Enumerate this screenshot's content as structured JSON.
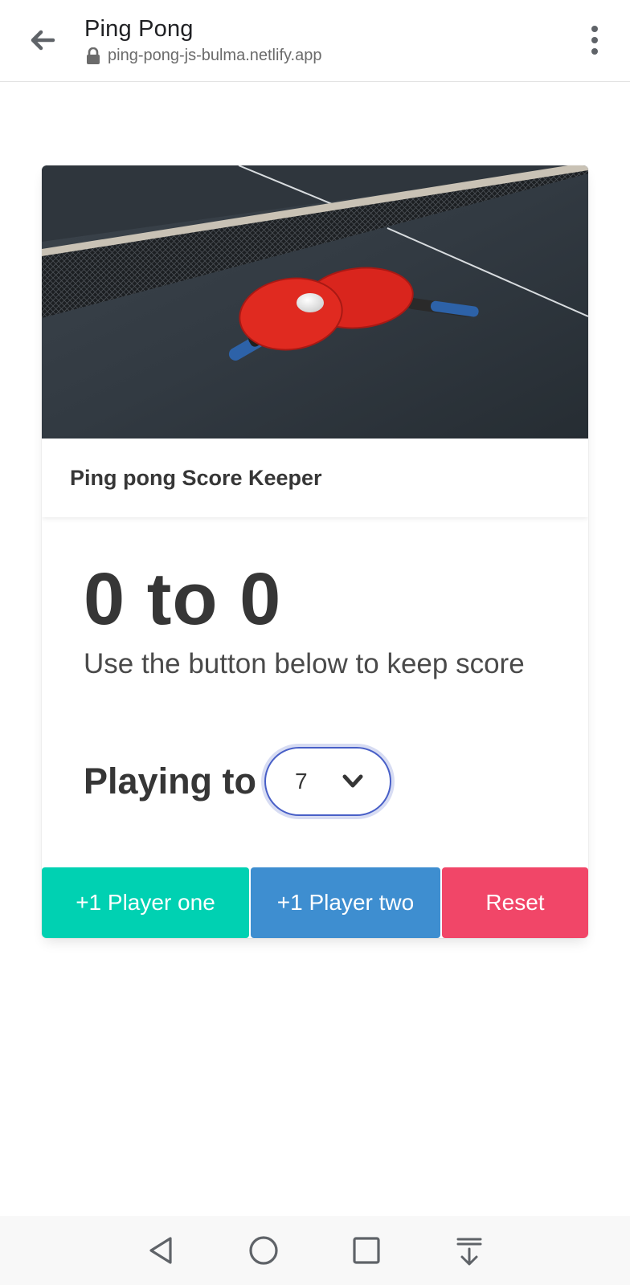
{
  "browser": {
    "title": "Ping Pong",
    "url": "ping-pong-js-bulma.netlify.app",
    "icons": {
      "back": "arrow-left-icon",
      "lock": "lock-icon",
      "menu": "more-vertical-icon"
    }
  },
  "card": {
    "image_alt": "ping pong paddles and ball on table",
    "header_title": "Ping pong Score Keeper",
    "score": "0 to 0",
    "subtitle": "Use the button below to keep score",
    "playing_to_label": "Playing to",
    "select": {
      "selected_value": "7",
      "icon": "chevron-down-icon"
    },
    "buttons": {
      "player_one": "+1 Player one",
      "player_two": "+1 Player two",
      "reset": "Reset"
    }
  },
  "colors": {
    "primary": "#00d1b2",
    "info": "#3e8ed0",
    "danger": "#f14668",
    "focus_ring": "#485fc7"
  },
  "android_nav": {
    "icons": [
      "back-triangle-icon",
      "home-circle-icon",
      "recents-square-icon",
      "notification-pull-icon"
    ]
  }
}
